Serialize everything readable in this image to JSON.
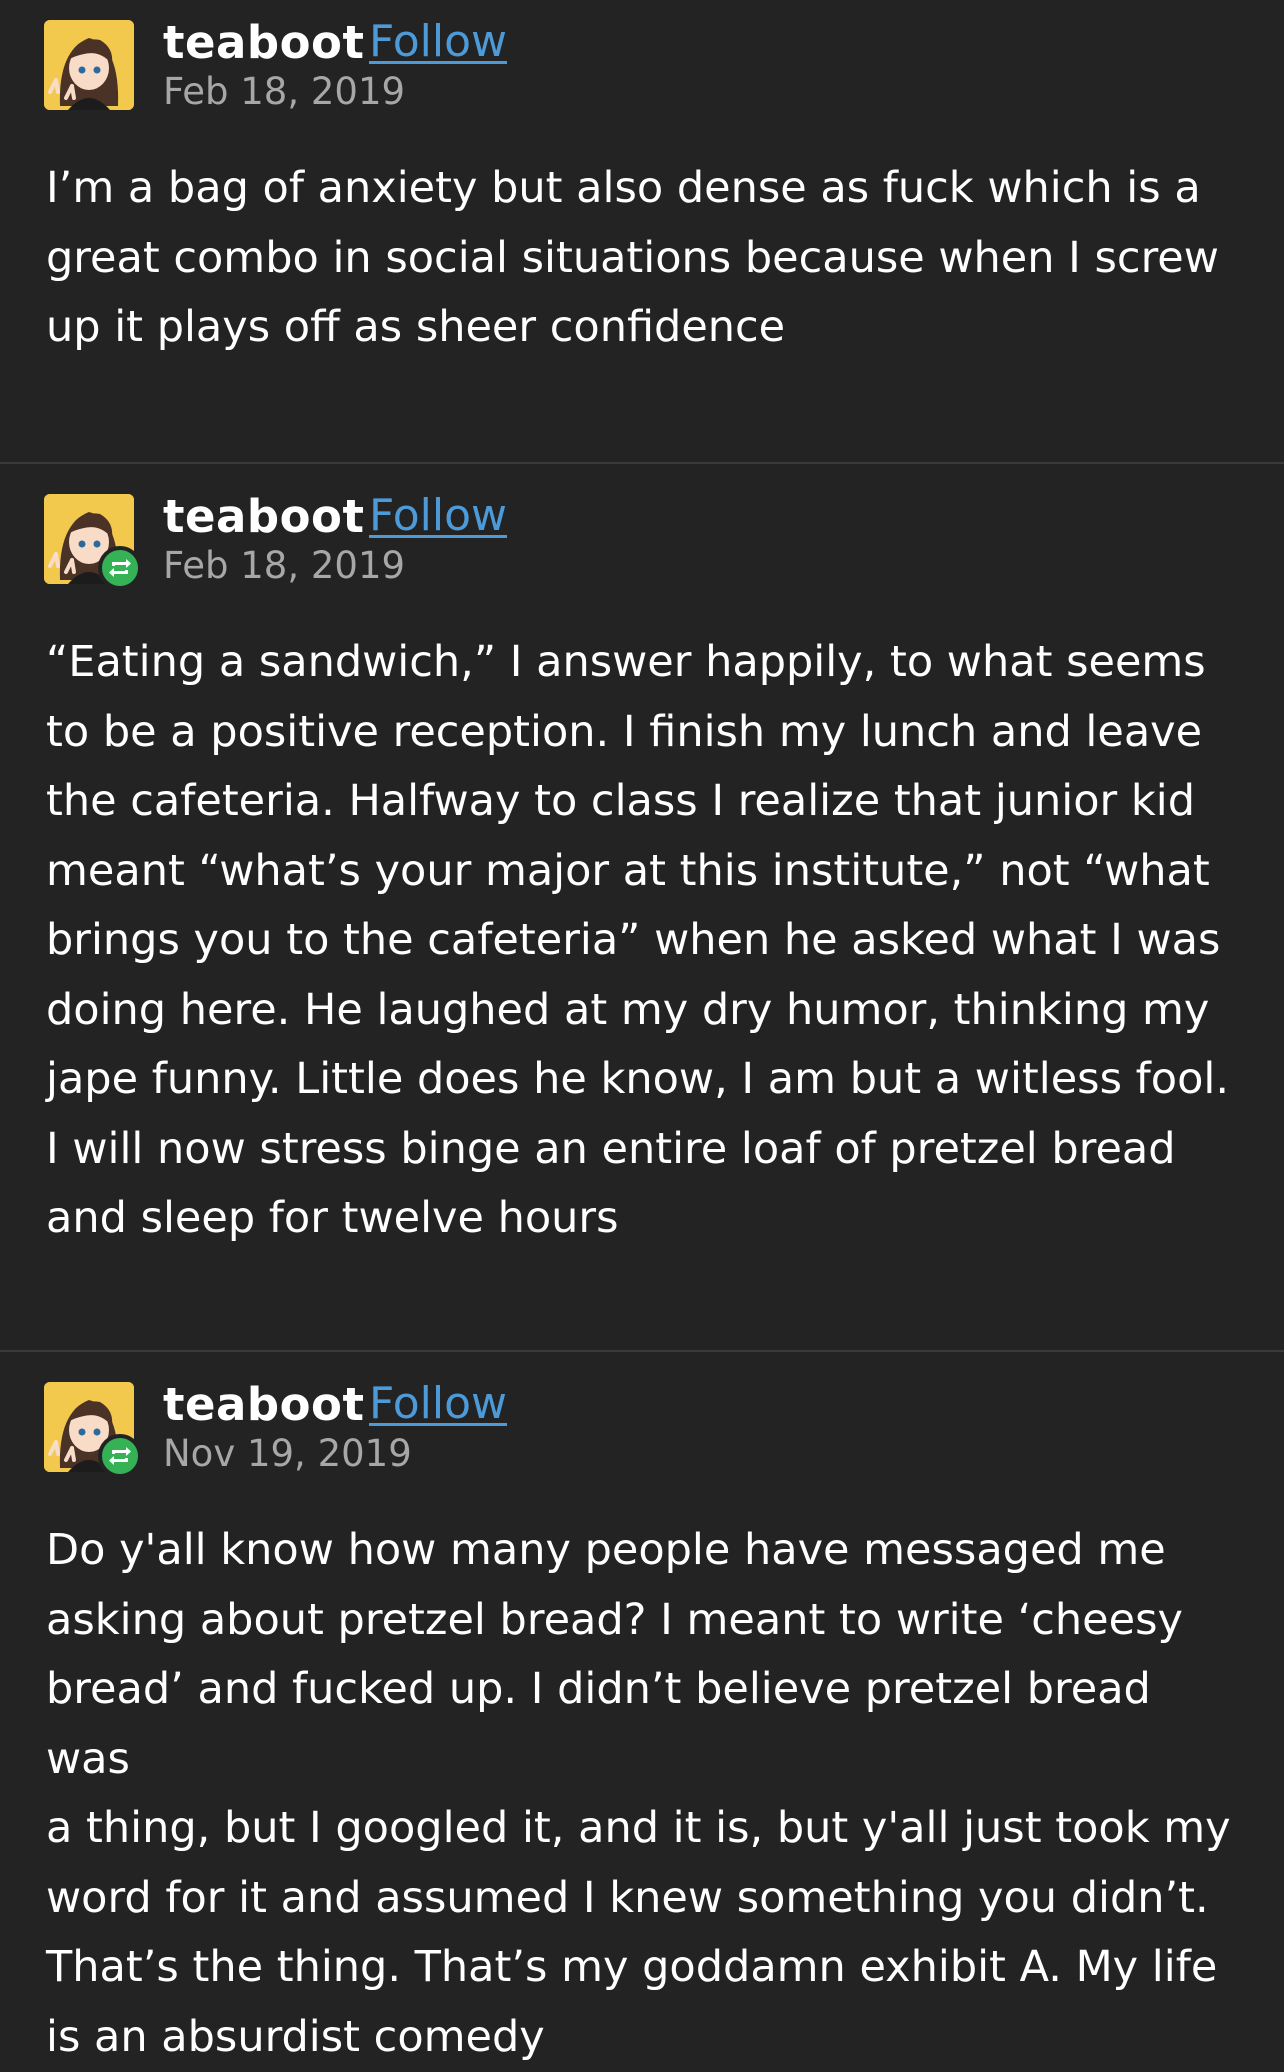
{
  "colors": {
    "background": "#232323",
    "text": "#ffffff",
    "follow_link": "#4d9ad8",
    "date_text": "#a7a7a7",
    "reblog_badge": "#35b256",
    "divider": "#3a3a3a"
  },
  "posts": [
    {
      "username": "teaboot",
      "follow_label": "Follow",
      "date": "Feb 18, 2019",
      "avatar_icon": "avatar-anime-peace-sign",
      "reblog_icon": null,
      "lines": [
        "I’m a bag of anxiety but also dense as fuck which is a",
        "great combo in social situations because when I screw",
        "up it plays off as sheer confidence"
      ]
    },
    {
      "username": "teaboot",
      "follow_label": "Follow",
      "date": "Feb 18, 2019",
      "avatar_icon": "avatar-anime-peace-sign",
      "reblog_icon": "reblog-icon",
      "lines": [
        "“Eating a sandwich,” I answer happily, to what seems",
        "to be a positive reception. I finish my lunch and leave",
        "the cafeteria. Halfway to class I realize that junior kid",
        "meant “what’s your major at this institute,” not “what",
        "brings you to the cafeteria” when he asked what I was",
        "doing here. He laughed at my dry humor, thinking my",
        "jape funny. Little does he know, I am but a witless fool.",
        "I will now stress binge an entire loaf of pretzel bread",
        "and sleep for twelve hours"
      ]
    },
    {
      "username": "teaboot",
      "follow_label": "Follow",
      "date": "Nov 19, 2019",
      "avatar_icon": "avatar-anime-peace-sign",
      "reblog_icon": "reblog-icon",
      "lines": [
        "Do y'all know how many people have messaged me",
        "asking about pretzel bread? I meant to write ‘cheesy",
        "bread’ and fucked up. I didn’t believe pretzel bread was",
        "a thing, but I googled it, and it is, but y'all just took my",
        "word for it and assumed I knew something you didn’t.",
        "That’s the thing. That’s my goddamn exhibit A. My life",
        "is an absurdist comedy"
      ]
    }
  ]
}
